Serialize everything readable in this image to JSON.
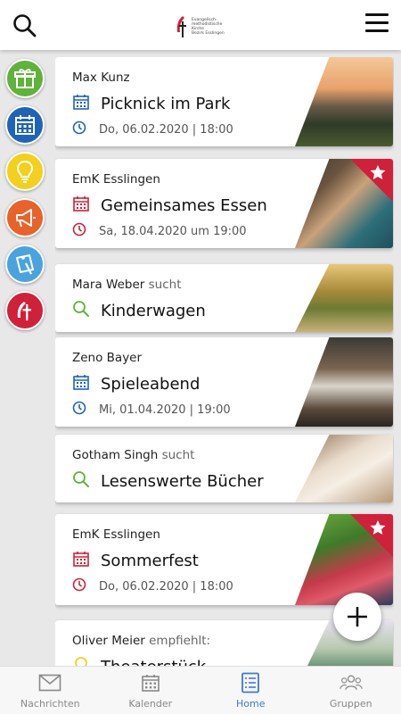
{
  "header": {
    "logo_lines": [
      "Evangelisch-",
      "methodistische",
      "Kirche",
      "Bezirk Esslingen"
    ]
  },
  "sidebar": [
    {
      "icon": "gift-icon",
      "color": "#5fb23a"
    },
    {
      "icon": "calendar-icon",
      "color": "#1f63b8"
    },
    {
      "icon": "lightbulb-icon",
      "color": "#f2d01b"
    },
    {
      "icon": "megaphone-icon",
      "color": "#e8622a"
    },
    {
      "icon": "note-icon",
      "color": "#4aa3df"
    },
    {
      "icon": "church-cross-icon",
      "color": "#d0203a"
    }
  ],
  "feed": [
    {
      "author": "Max Kunz",
      "verb": "",
      "title": "Picknick im Park",
      "meta": "Do, 06.02.2020 | 18:00",
      "type": "event",
      "accent": "#1f63b8",
      "featured": false
    },
    {
      "author": "EmK Esslingen",
      "verb": "",
      "title": "Gemeinsames Essen",
      "meta": "Sa, 18.04.2020 um 19:00",
      "type": "event",
      "accent": "#d0203a",
      "featured": true
    },
    {
      "author": "Mara Weber",
      "verb": "sucht",
      "title": "Kinderwagen",
      "meta": "",
      "type": "search",
      "accent": "#5fb23a",
      "featured": false
    },
    {
      "author": "Zeno Bayer",
      "verb": "",
      "title": "Spieleabend",
      "meta": "Mi, 01.04.2020 | 19:00",
      "type": "event",
      "accent": "#1f63b8",
      "featured": false
    },
    {
      "author": "Gotham Singh",
      "verb": "sucht",
      "title": "Lesenswerte Bücher",
      "meta": "",
      "type": "search",
      "accent": "#5fb23a",
      "featured": false
    },
    {
      "author": "EmK Esslingen",
      "verb": "",
      "title": "Sommerfest",
      "meta": "Do, 06.02.2020 | 18:00",
      "type": "event",
      "accent": "#d0203a",
      "featured": true
    },
    {
      "author": "Oliver Meier",
      "verb": "empfiehlt:",
      "title": "Theaterstück",
      "meta": "",
      "type": "recommend",
      "accent": "#f2d01b",
      "featured": false
    }
  ],
  "fab": {
    "icon": "plus-icon"
  },
  "bottom_nav": [
    {
      "label": "Nachrichten",
      "icon": "mail-icon",
      "active": false
    },
    {
      "label": "Kalender",
      "icon": "calendar-icon",
      "active": false
    },
    {
      "label": "Home",
      "icon": "list-icon",
      "active": true
    },
    {
      "label": "Gruppen",
      "icon": "group-icon",
      "active": false
    }
  ],
  "colors": {
    "accent": "#3a7bd5",
    "ribbon": "#d0203a"
  }
}
